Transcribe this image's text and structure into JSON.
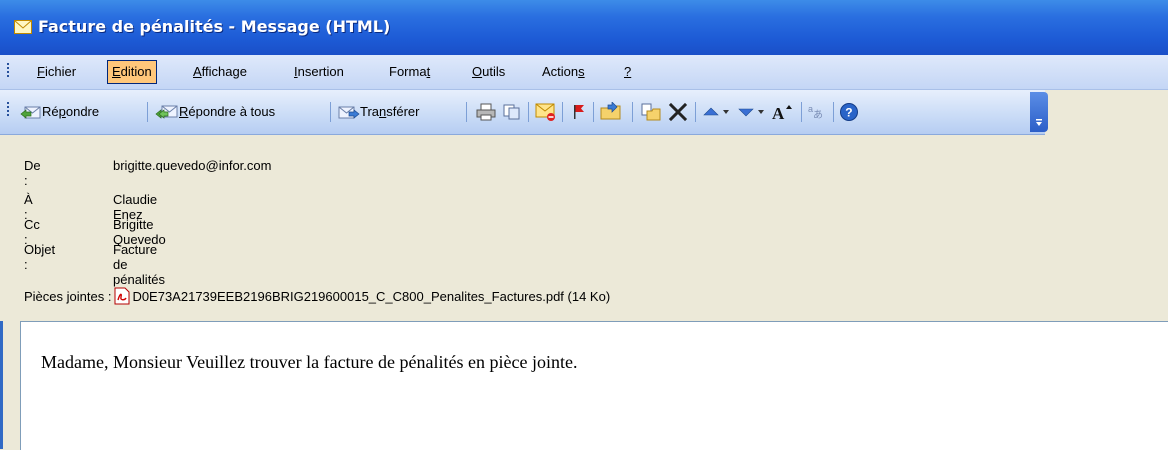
{
  "window": {
    "title": "Facture de pénalités - Message (HTML)",
    "title_icon": "envelope-icon"
  },
  "menubar": {
    "items": [
      {
        "label_u": "F",
        "label_rest": "ichier"
      },
      {
        "label_u": "E",
        "label_rest": "dition"
      },
      {
        "label_u": "A",
        "label_rest": "ffichage"
      },
      {
        "label_u": "I",
        "label_rest": "nsertion"
      },
      {
        "label_pre": "Forma",
        "label_u": "t",
        "label_rest": ""
      },
      {
        "label_u": "O",
        "label_rest": "utils"
      },
      {
        "label_pre": "Action",
        "label_u": "s",
        "label_rest": ""
      },
      {
        "label_u": "?",
        "label_rest": ""
      }
    ]
  },
  "toolbar": {
    "reply_pre": "Ré",
    "reply_u": "p",
    "reply_rest": "ondre",
    "reply_all_u": "R",
    "reply_all_rest": "épondre à tous",
    "forward_pre": "Tra",
    "forward_u": "n",
    "forward_rest": "sférer",
    "icons": [
      "print-icon",
      "copy-icon",
      "unread-icon",
      "flag-icon",
      "move-icon",
      "copy-folder-icon",
      "delete-icon",
      "previous-icon",
      "next-icon",
      "font-size-icon",
      "encoding-icon",
      "help-icon"
    ]
  },
  "header": {
    "from_label": "De :",
    "from_value": "brigitte.quevedo@infor.com",
    "to_label": "À :",
    "to_value": "Claudie Enez",
    "cc_label": "Cc :",
    "cc_value": "Brigitte Quevedo",
    "subject_label": "Objet :",
    "subject_value": "Facture de pénalités",
    "attachments_label": "Pièces jointes :",
    "attachment_name": "D0E73A21739EEB2196BRIG219600015_C_C800_Penalites_Factures.pdf (14 Ko)"
  },
  "body": {
    "text": "Madame, Monsieur Veuillez trouver la facture de pénalités en pièce jointe."
  },
  "colors": {
    "titlebar": "#2a6fe0",
    "menu_active": "#ffc77a",
    "header_bg": "#ece9d8"
  }
}
